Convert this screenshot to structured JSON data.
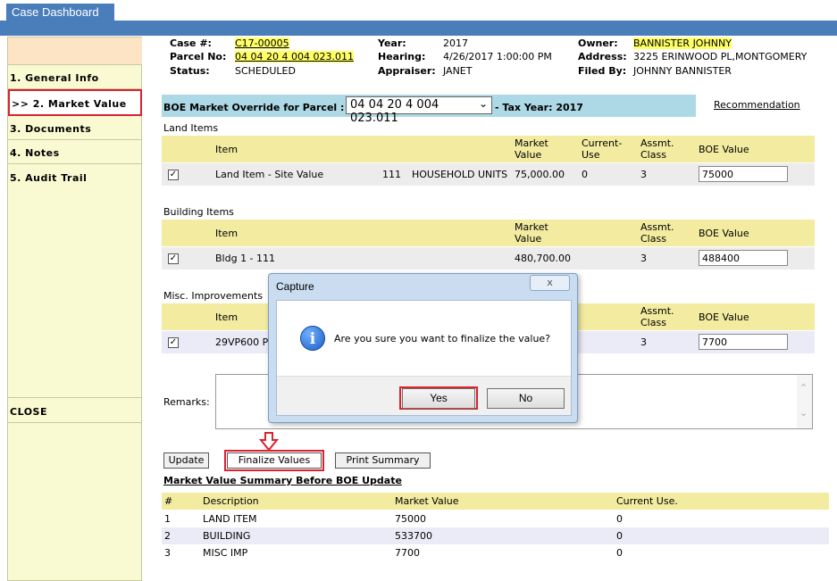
{
  "app": {
    "tab_title": "Case Dashboard"
  },
  "sidebar": {
    "items": [
      {
        "label": "1. General Info"
      },
      {
        "label": ">> 2. Market Value"
      },
      {
        "label": "3. Documents"
      },
      {
        "label": "4. Notes"
      },
      {
        "label": "5. Audit Trail"
      }
    ],
    "close_label": "CLOSE"
  },
  "case_info": {
    "case_label": "Case #:",
    "case_value": "C17-00005",
    "parcel_label": "Parcel No:",
    "parcel_value": "04 04 20 4 004 023.011",
    "status_label": "Status:",
    "status_value": "SCHEDULED",
    "year_label": "Year:",
    "year_value": "2017",
    "hearing_label": "Hearing:",
    "hearing_value": "4/26/2017 1:00:00 PM",
    "appraiser_label": "Appraiser:",
    "appraiser_value": "JANET",
    "owner_label": "Owner:",
    "owner_value": "BANNISTER JOHNNY",
    "address_label": "Address:",
    "address_value": "3225 ERINWOOD PL,MONTGOMERY",
    "filedby_label": "Filed By:",
    "filedby_value": "JOHNNY BANNISTER"
  },
  "override_bar": {
    "label": "BOE Market Override for Parcel :",
    "parcel_select": "04 04 20 4 004 023.011",
    "tax_year": "- Tax Year: 2017",
    "recommendation": "Recommendation"
  },
  "land": {
    "title": "Land Items",
    "headers": {
      "item": "Item",
      "market": "Market Value",
      "current": "Current-Use",
      "class": "Assmt. Class",
      "boe": "BOE Value"
    },
    "row": {
      "item": "Land Item - Site Value",
      "code": "111",
      "units": "HOUSEHOLD UNITS",
      "market": "75,000.00",
      "current": "0",
      "class": "3",
      "boe": "75000"
    }
  },
  "building": {
    "title": "Building Items",
    "headers": {
      "item": "Item",
      "market": "Market Value",
      "class": "Assmt. Class",
      "boe": "BOE Value"
    },
    "row": {
      "item": "Bldg 1 - 111",
      "market": "480,700.00",
      "class": "3",
      "boe": "488400"
    }
  },
  "misc": {
    "title": "Misc. Improvements",
    "headers": {
      "item": "Item",
      "class": "Assmt. Class",
      "boe": "BOE Value"
    },
    "row": {
      "item": "29VP600 P",
      "class": "3",
      "boe": "7700"
    }
  },
  "remarks": {
    "label": "Remarks:"
  },
  "actions": {
    "update": "Update",
    "finalize": "Finalize Values",
    "print": "Print Summary"
  },
  "summary": {
    "title": "Market Value Summary Before BOE Update",
    "headers": {
      "num": "#",
      "desc": "Description",
      "market": "Market Value",
      "current": "Current Use."
    },
    "rows": [
      {
        "num": "1",
        "desc": "LAND ITEM",
        "market": "75000",
        "current": "0"
      },
      {
        "num": "2",
        "desc": "BUILDING",
        "market": "533700",
        "current": "0"
      },
      {
        "num": "3",
        "desc": "MISC IMP",
        "market": "7700",
        "current": "0"
      }
    ]
  },
  "dialog": {
    "title": "Capture",
    "close_glyph": "x",
    "message": "Are you sure you want to finalize the value?",
    "yes": "Yes",
    "no": "No"
  },
  "colors": {
    "accent_blue": "#4a7ebb",
    "highlight_red": "#d9232f",
    "sidebar_bg": "#fafad2",
    "header_yellow": "#f2eba0",
    "bar_blue": "#add8e6"
  }
}
